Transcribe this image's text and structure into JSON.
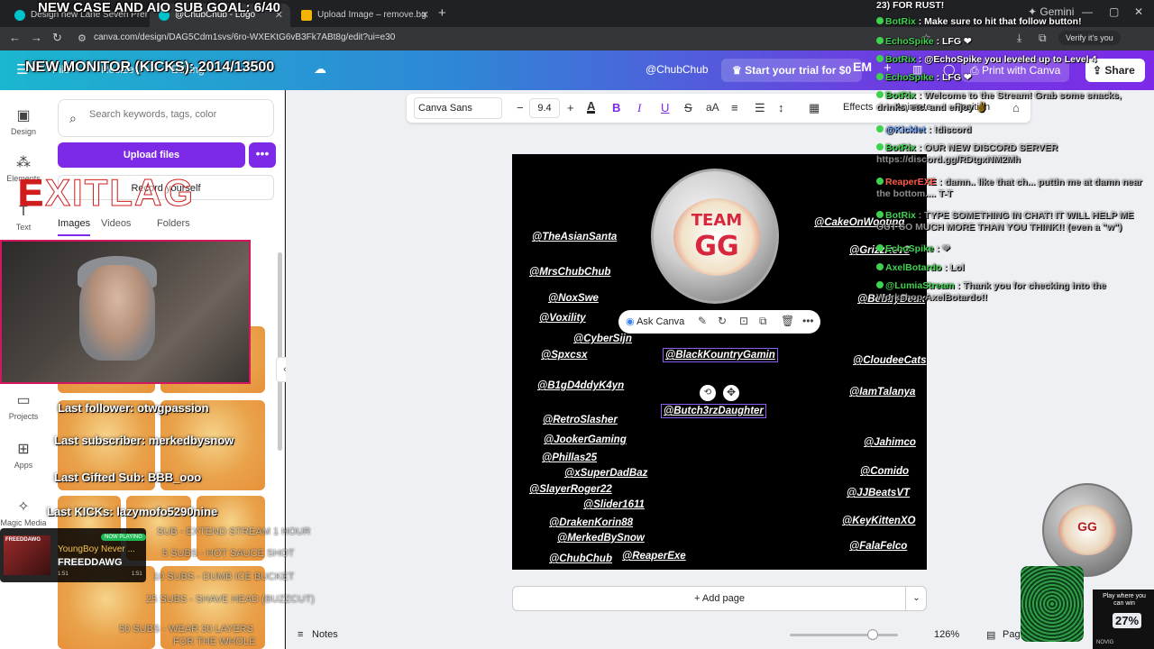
{
  "browser": {
    "tabs": [
      {
        "label": "Design new Lane Seven Premie...",
        "active": false
      },
      {
        "label": "@ChubChub - Logo",
        "active": true
      },
      {
        "label": "Upload Image – remove.bg",
        "active": false
      }
    ],
    "url": "canva.com/design/DAG5Cdm1svs/6ro-WXEKtG6vB3Fk7ABt8g/edit?ui=e30",
    "verify_label": "Verify it's you",
    "gemini_label": "Gemini"
  },
  "canva": {
    "menu": {
      "file": "File",
      "resize": "Resize",
      "editing": "Editing"
    },
    "user_handle": "@ChubChub",
    "trial_button": "Start your trial for $0",
    "avatar_initials": "EM",
    "print_button": "Print with Canva",
    "share_button": "Share",
    "rail": [
      {
        "label": "Design"
      },
      {
        "label": "Elements"
      },
      {
        "label": "Text"
      },
      {
        "label": "Projects"
      },
      {
        "label": "Apps"
      },
      {
        "label": "Magic Media"
      }
    ],
    "search_placeholder": "Search keywords, tags, color",
    "upload_button": "Upload files",
    "record_button": "Record yourself",
    "panel_tabs": [
      "Images",
      "Videos",
      "Folders"
    ],
    "toolbar": {
      "font": "Canva Sans",
      "font_size": "9.4",
      "effects": "Effects",
      "animate": "Animate",
      "position": "Position"
    },
    "ask_canva": "Ask Canva",
    "add_page": "+ Add page",
    "notes": "Notes",
    "zoom": "126%",
    "pages": "Pages"
  },
  "design": {
    "coin_top": "TEAM",
    "coin_bottom": "GG",
    "names_left": [
      "@TheAsianSanta",
      "@MrsChubChub",
      "@NoxSwe",
      "@Voxility",
      "@CyberSijn",
      "@Spxcsx",
      "@B1gD4ddyK4yn",
      "@RetroSlasher",
      "@JookerGaming",
      "@Phillas25",
      "@xSuperDadBaz",
      "@SlayerRoger22",
      "@Slider1611",
      "@DrakenKorin88",
      "@MerkedBySnow",
      "@ChubChub",
      "@ReaperExe"
    ],
    "names_right": [
      "@CakeOnWooting",
      "@GrizzRev3",
      "@BobbyDeux",
      "@CloudeeCats",
      "@IamTalanya",
      "@Jahimco",
      "@Comido",
      "@JJBeatsVT",
      "@KeyKittenXO",
      "@FalaFelco"
    ],
    "selected_names": [
      "@BlackKountryGamin",
      "@Butch3rzDaughter"
    ]
  },
  "overlay": {
    "case_goal": "NEW CASE AND AIO SUB GOAL: 6/40",
    "monitor_goal": "NEW MONITOR (KICKS): 2014/13500",
    "sponsor": "EXITLAG",
    "last_follower": "Last follower: otwgpassion",
    "last_subscriber": "Last subscriber: merkedbysnow",
    "last_gifted": "Last Gifted Sub: BBB_ooo",
    "last_kicks": "Last KICKs: lazymofo5290nine",
    "sub_goals": [
      "SUB - EXTEND STREAM 1 HOUR",
      "5 SUBS - HOT SAUCE SHOT",
      "10 SUBS - DUMB ICE BUCKET",
      "25 SUBS - SHAVE HEAD (BUZZCUT)",
      "50 SUBS - WEAR 30 LAYERS",
      "FOR THE WHOLE"
    ],
    "now_playing": {
      "badge": "NOW PLAYING",
      "song": "YoungBoy Never ...",
      "artist": "FREEDDAWG",
      "elapsed": "1:51",
      "webcam_label": "FREEDDAWG"
    },
    "ad": {
      "headline": "Play where you can win",
      "percent": "27%",
      "brand": "NOVIG"
    }
  },
  "chat": [
    {
      "user": "",
      "text": "23) FOR RUST!",
      "style": "plain"
    },
    {
      "user": "BotRix",
      "text": ": Make sure to hit that follow button!",
      "style": "green"
    },
    {
      "user": "EchoSpike",
      "text": ": LFG ❤",
      "style": "plain"
    },
    {
      "user": "BotRix",
      "text": ": @EchoSpike you leveled up to Level 4",
      "style": "green"
    },
    {
      "user": "EchoSpike",
      "text": ": LFG ❤",
      "style": "plain"
    },
    {
      "user": "BotRix",
      "text": ": Welcome to the Stream! Grab some snacks, drinks, etc. and enjoy ✌",
      "style": "dim"
    },
    {
      "user": "@Kicklet",
      "text": ": !discord",
      "style": "dim-blue"
    },
    {
      "user": "BotRix",
      "text": ": OUR NEW DISCORD SERVER https://discord.gg/RDtgxNM2Mh",
      "style": "dim"
    },
    {
      "user": "ReaperEXE",
      "text": ": damn.. like that ch... puttin me at damn near the bottom.... T-T",
      "style": "dim-red"
    },
    {
      "user": "BotRix",
      "text": ": TYPE SOMETHING IN CHAT! IT WILL HELP ME OUT SO MUCH MORE THAN YOU THINK!! (even a \"w\")",
      "style": "dim"
    },
    {
      "user": "EchoSpike",
      "text": ": ❤",
      "style": "dim"
    },
    {
      "user": "AxelBotardo",
      "text": ": Lol",
      "style": "dim"
    },
    {
      "user": "@LumiaStream",
      "text": ": Thank you for checking into the Workshop AxelBotardo!!",
      "style": "dim"
    }
  ]
}
